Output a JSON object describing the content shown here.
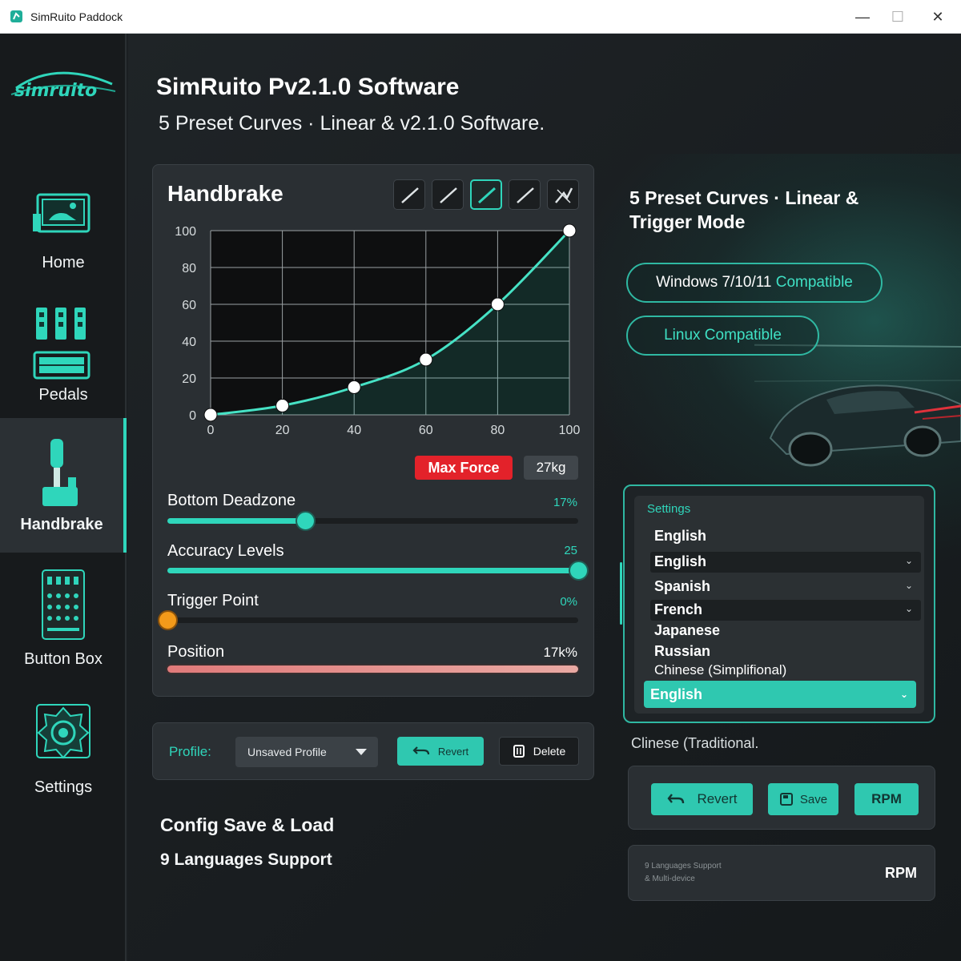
{
  "window": {
    "title": "SimRuito Paddock",
    "minimize": "—",
    "maximize": "☐",
    "close": "✕"
  },
  "logo": {
    "text": "simruito"
  },
  "sidebar": {
    "items": [
      {
        "label": "Home",
        "icon": "home-icon"
      },
      {
        "label": "Pedals",
        "icon": "pedals-icon"
      },
      {
        "label": "Handbrake",
        "icon": "handbrake-icon",
        "active": true
      },
      {
        "label": "Button Box",
        "icon": "button-box-icon"
      },
      {
        "label": "Settings",
        "icon": "settings-icon"
      }
    ]
  },
  "hero": {
    "title": "SimRuito Pv2.1.0 Software",
    "subtitle": "5 Preset Curves · Linear & v2.1.0 Software."
  },
  "handbrake": {
    "title": "Handbrake",
    "curve_presets_selected": 3,
    "max_force_label": "Max Force",
    "max_force_value": "27kg",
    "sliders": [
      {
        "label": "Bottom Deadzone",
        "value": "17%",
        "fill_fraction": 0.335
      },
      {
        "label": "Accuracy Levels",
        "value": "25",
        "fill_fraction": 1.0
      },
      {
        "label": "Trigger Point",
        "value": "0%",
        "fill_fraction": 0.0
      }
    ],
    "position": {
      "label": "Position",
      "value": "17k%"
    }
  },
  "chart_data": {
    "type": "line",
    "title": "",
    "xlabel": "",
    "ylabel": "",
    "x_ticks": [
      "0",
      "20",
      "40",
      "60",
      "80",
      "100"
    ],
    "y_ticks": [
      "0",
      "20",
      "40",
      "60",
      "80",
      "100"
    ],
    "xlim": [
      0,
      100
    ],
    "ylim": [
      0,
      100
    ],
    "grid": true,
    "series": [
      {
        "x": [
          0,
          20,
          40,
          60,
          80,
          100
        ],
        "y": [
          0,
          5,
          15,
          30,
          60,
          100
        ]
      }
    ]
  },
  "profile": {
    "label": "Profile:",
    "selected": "Unsaved Profile",
    "revert_label": "Revert",
    "delete_label": "Delete"
  },
  "features": {
    "config": "Config Save & Load",
    "languages": "9 Languages Support"
  },
  "promo": {
    "title": "5 Preset Curves · Linear & Trigger Mode",
    "windows_prefix": "Windows 7/10/11",
    "windows_suffix": "Compatible",
    "linux": "Linux Compatible"
  },
  "settings": {
    "tag": "Settings",
    "languages": [
      "English",
      "English",
      "Spanish",
      "French",
      "Japanese",
      "Russian",
      "Chinese (Simplifional)"
    ],
    "selected": "English",
    "below": "Clinese (Traditional."
  },
  "actions": {
    "revert": "Revert",
    "save": "Save",
    "rpm": "RPM"
  },
  "footer": {
    "line1": "9 Languages Support",
    "line2": "& Multi-device",
    "rpm": "RPM"
  },
  "colors": {
    "accent": "#2fd6bb",
    "danger": "#e3222a",
    "warning": "#f39a1a",
    "background": "#1b1f22"
  }
}
